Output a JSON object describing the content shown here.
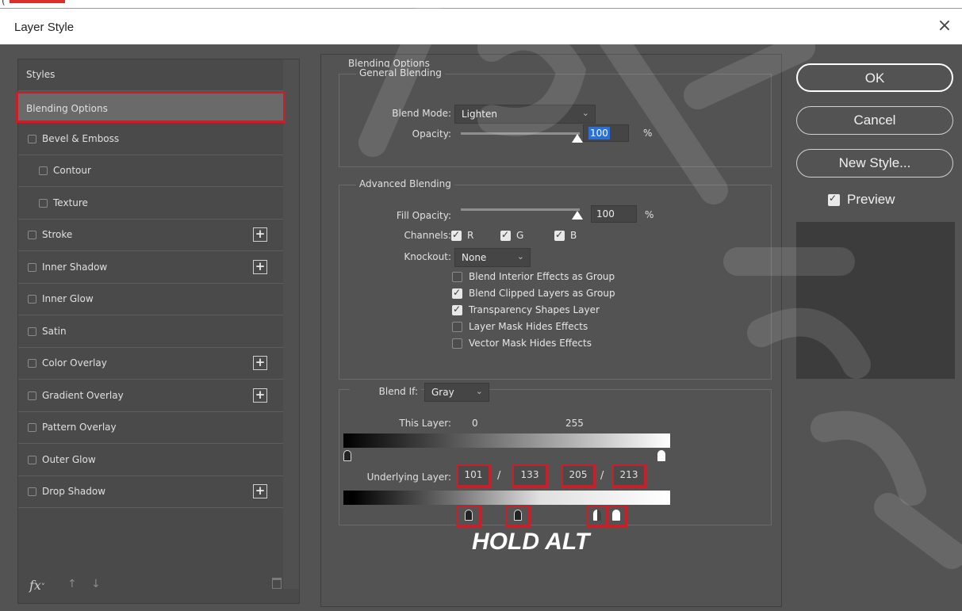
{
  "window": {
    "title": "Layer Style",
    "close_label": "×"
  },
  "styles_panel": {
    "header": "Styles",
    "items": [
      {
        "label": "Blending Options",
        "has_checkbox": false,
        "has_add": false,
        "selected": true
      },
      {
        "label": "Bevel & Emboss",
        "has_checkbox": true,
        "has_add": false
      },
      {
        "label": "Contour",
        "has_checkbox": true,
        "has_add": false,
        "indent": true
      },
      {
        "label": "Texture",
        "has_checkbox": true,
        "has_add": false,
        "indent": true
      },
      {
        "label": "Stroke",
        "has_checkbox": true,
        "has_add": true
      },
      {
        "label": "Inner Shadow",
        "has_checkbox": true,
        "has_add": true
      },
      {
        "label": "Inner Glow",
        "has_checkbox": true,
        "has_add": false
      },
      {
        "label": "Satin",
        "has_checkbox": true,
        "has_add": false
      },
      {
        "label": "Color Overlay",
        "has_checkbox": true,
        "has_add": true
      },
      {
        "label": "Gradient Overlay",
        "has_checkbox": true,
        "has_add": true
      },
      {
        "label": "Pattern Overlay",
        "has_checkbox": true,
        "has_add": false
      },
      {
        "label": "Outer Glow",
        "has_checkbox": true,
        "has_add": false
      },
      {
        "label": "Drop Shadow",
        "has_checkbox": true,
        "has_add": true
      }
    ],
    "footer": {
      "fx_label": "fx",
      "fx_suffix": "˅",
      "up_icon": "↑",
      "down_icon": "↓"
    }
  },
  "blending_options": {
    "title": "Blending Options",
    "general": {
      "title": "General Blending",
      "blend_mode_label": "Blend Mode:",
      "blend_mode_value": "Lighten",
      "opacity_label": "Opacity:",
      "opacity_value": "100",
      "unit": "%"
    },
    "advanced": {
      "title": "Advanced Blending",
      "fill_opacity_label": "Fill Opacity:",
      "fill_opacity_value": "100",
      "unit": "%",
      "channels_label": "Channels:",
      "channels": [
        {
          "label": "R",
          "checked": true
        },
        {
          "label": "G",
          "checked": true
        },
        {
          "label": "B",
          "checked": true
        }
      ],
      "knockout_label": "Knockout:",
      "knockout_value": "None",
      "options": [
        {
          "label": "Blend Interior Effects as Group",
          "checked": false
        },
        {
          "label": "Blend Clipped Layers as Group",
          "checked": true
        },
        {
          "label": "Transparency Shapes Layer",
          "checked": true
        },
        {
          "label": "Layer Mask Hides Effects",
          "checked": false
        },
        {
          "label": "Vector Mask Hides Effects",
          "checked": false
        }
      ]
    },
    "blend_if": {
      "label": "Blend If:",
      "value": "Gray",
      "this_layer_label": "This Layer:",
      "this_layer_values": [
        "0",
        "255"
      ],
      "underlying_label": "Underlying Layer:",
      "underlying_values": [
        "101",
        "133",
        "205",
        "213"
      ],
      "separator": "/"
    },
    "annotation": "HOLD ALT"
  },
  "buttons": {
    "ok": "OK",
    "cancel": "Cancel",
    "new_style": "New Style...",
    "preview_label": "Preview",
    "preview_checked": true
  }
}
